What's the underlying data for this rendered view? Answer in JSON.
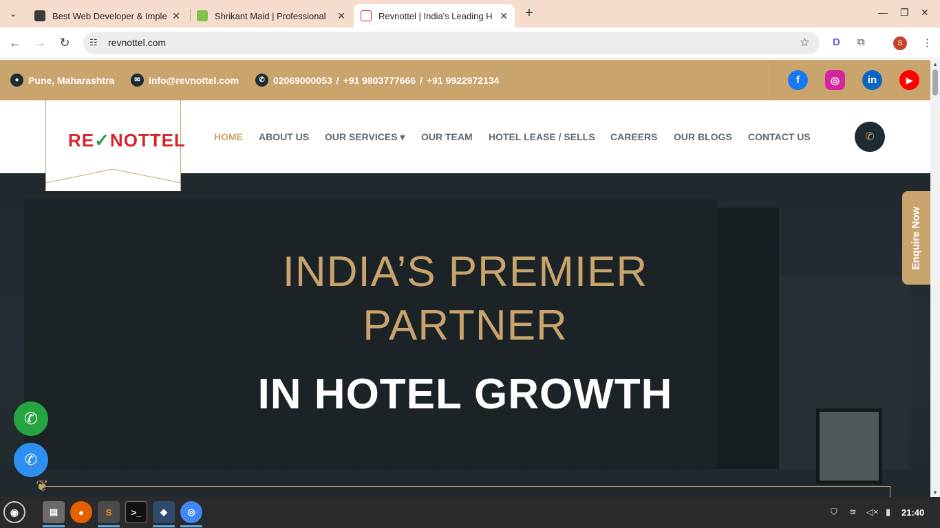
{
  "browser": {
    "tabs": [
      {
        "title": "Best Web Developer & Imple",
        "active": false
      },
      {
        "title": "Shrikant Maid | Professional",
        "active": false
      },
      {
        "title": "Revnottel | India's Leading H",
        "active": true
      }
    ],
    "url": "revnottel.com",
    "profile_initial": "S"
  },
  "topbar": {
    "location": "Pune, Maharashtra",
    "email": "info@revnottel.com",
    "phone1": "02069000053",
    "phone2": "+91 9803777666",
    "phone3": "+91 9922972134",
    "sep": "/"
  },
  "social": {
    "facebook": "f",
    "instagram": "◎",
    "linkedin": "in",
    "youtube": "▶"
  },
  "logo": {
    "text_left": "RE",
    "text_tick": "✓",
    "text_right": "NOTTEL",
    "reg": "®"
  },
  "nav": {
    "home": "HOME",
    "about": "ABOUT US",
    "services": "OUR SERVICES ▾",
    "team": "OUR TEAM",
    "lease": "HOTEL LEASE / SELLS",
    "careers": "CAREERS",
    "blogs": "OUR BLOGS",
    "contact": "CONTACT US"
  },
  "hero": {
    "line1": "INDIA’S PREMIER",
    "line2": "PARTNER",
    "line3": "IN HOTEL GROWTH"
  },
  "enquire": "Enquire Now",
  "taskbar": {
    "time": "21:40"
  },
  "colors": {
    "accent": "#c9a46d",
    "dark": "#1e2b33",
    "tabbar": "#f6dccd"
  }
}
